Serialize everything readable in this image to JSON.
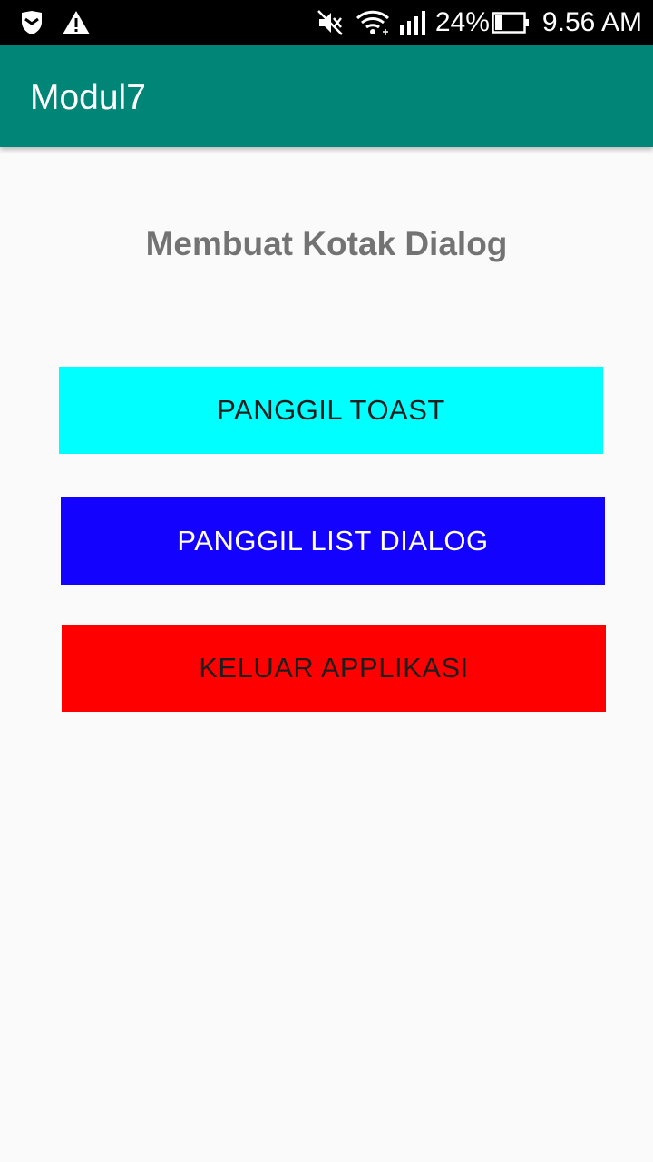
{
  "status_bar": {
    "battery_percent": "24%",
    "time": "9.56 AM",
    "icons": [
      "shield-icon",
      "warning-icon",
      "mute-icon",
      "wifi-icon",
      "signal-icon",
      "battery-icon"
    ],
    "battery_level": 0.24
  },
  "app_bar": {
    "title": "Modul7",
    "color": "#008577"
  },
  "main": {
    "heading": "Membuat Kotak Dialog",
    "buttons": [
      {
        "label": "PANGGIL TOAST",
        "color": "#00ffff"
      },
      {
        "label": "PANGGIL LIST DIALOG",
        "color": "#1402ff"
      },
      {
        "label": "KELUAR APPLIKASI",
        "color": "#ff0000"
      }
    ]
  }
}
